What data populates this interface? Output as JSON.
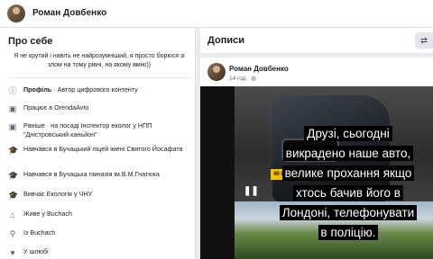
{
  "header": {
    "name": "Роман Довбенко"
  },
  "about": {
    "title": "Про себе",
    "bio": "Я не крутий і навіть не найрозумніший, я просто борюся зі злом на тому рівні, на якому вмію))",
    "items": [
      {
        "icon": "info-icon",
        "label": "Профіль",
        "text": " · Автор цифрового контенту"
      },
      {
        "icon": "briefcase-icon",
        "label": "",
        "text": "Працює в OrendaAvto"
      },
      {
        "icon": "briefcase-icon",
        "label": "",
        "text": "Раніше · на посаді Інспектор еколог у НПП \"Дністровський каньйон\""
      },
      {
        "icon": "graduation-cap-icon",
        "label": "",
        "text": "Навчався в Бучацький ліцей імені Святого Йосафата"
      },
      {
        "icon": "graduation-cap-icon",
        "label": "",
        "text": "Навчався в Бучацька гімназія ім.В.М.Гнатюка"
      },
      {
        "icon": "graduation-cap-icon",
        "label": "",
        "text": "Вивчає Екологія у ЧНУ"
      },
      {
        "icon": "home-icon",
        "label": "",
        "text": "Живе у Buchach"
      },
      {
        "icon": "location-pin-icon",
        "label": "",
        "text": "Із Buchach"
      },
      {
        "icon": "heart-icon",
        "label": "",
        "text": "У шлюбі"
      }
    ]
  },
  "posts": {
    "title": "Дописи",
    "post": {
      "author": "Роман Довбенко",
      "time": "14 год · ",
      "plate": "40 0994 AB",
      "caption_lines": [
        "Друзі, сьогодні",
        "викрадено наше авто,",
        "велике прохання якщо",
        "хтось бачив його в",
        "Лондоні, телефонувати",
        "в поліцію."
      ]
    }
  }
}
